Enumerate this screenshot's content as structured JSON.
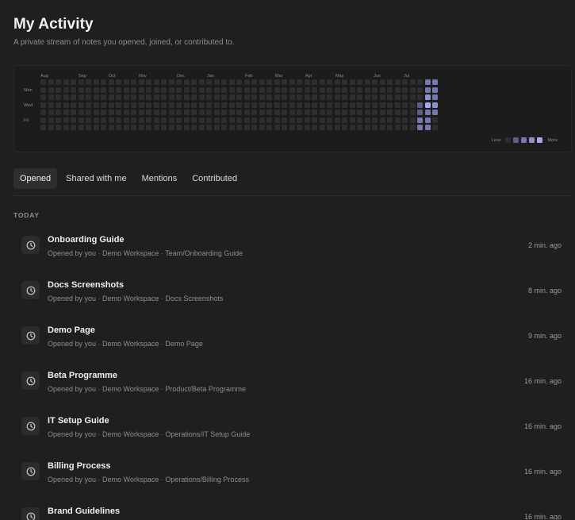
{
  "page": {
    "title": "My Activity",
    "subtitle": "A private stream of notes you opened, joined, or contributed to."
  },
  "heatmap": {
    "months": [
      "Aug",
      "Sep",
      "Oct",
      "Nov",
      "Dec",
      "Jan",
      "Feb",
      "Mar",
      "Apr",
      "May",
      "Jun",
      "Jul"
    ],
    "days": [
      "Mon",
      "Wed",
      "Fri"
    ],
    "legend_less": "Less",
    "legend_more": "More",
    "colors": {
      "empty": "#2e2e2e",
      "level1": "#5d5d85",
      "level2": "#7676b0",
      "level3": "#9090d0",
      "level4": "#a8a8e8"
    },
    "activity": [
      {
        "week": 50,
        "day": 0,
        "level": 0
      },
      {
        "week": 51,
        "day": 0,
        "level": 2
      },
      {
        "week": 52,
        "day": 0,
        "level": 2
      },
      {
        "week": 51,
        "day": 1,
        "level": 2
      },
      {
        "week": 52,
        "day": 1,
        "level": 2
      },
      {
        "week": 51,
        "day": 2,
        "level": 3
      },
      {
        "week": 52,
        "day": 2,
        "level": 2
      },
      {
        "week": 50,
        "day": 3,
        "level": 1
      },
      {
        "week": 51,
        "day": 3,
        "level": 4
      },
      {
        "week": 52,
        "day": 3,
        "level": 3
      },
      {
        "week": 50,
        "day": 4,
        "level": 1
      },
      {
        "week": 51,
        "day": 4,
        "level": 2
      },
      {
        "week": 52,
        "day": 4,
        "level": 2
      },
      {
        "week": 50,
        "day": 5,
        "level": 2
      },
      {
        "week": 51,
        "day": 5,
        "level": 2
      },
      {
        "week": 50,
        "day": 6,
        "level": 2
      },
      {
        "week": 51,
        "day": 6,
        "level": 2
      }
    ]
  },
  "tabs": [
    {
      "label": "Opened"
    },
    {
      "label": "Shared with me"
    },
    {
      "label": "Mentions"
    },
    {
      "label": "Contributed"
    }
  ],
  "section": {
    "label": "TODAY"
  },
  "items": [
    {
      "title": "Onboarding Guide",
      "meta": "Opened by you · Demo Workspace · Team/Onboarding Guide",
      "time": "2 min. ago",
      "icon": "clock-icon"
    },
    {
      "title": "Docs Screenshots",
      "meta": "Opened by you · Demo Workspace · Docs Screenshots",
      "time": "8 min. ago",
      "icon": "clock-icon"
    },
    {
      "title": "Demo Page",
      "meta": "Opened by you · Demo Workspace · Demo Page",
      "time": "9 min. ago",
      "icon": "clock-icon"
    },
    {
      "title": "Beta Programme",
      "meta": "Opened by you · Demo Workspace · Product/Beta Programme",
      "time": "16 min. ago",
      "icon": "clock-icon"
    },
    {
      "title": "IT Setup Guide",
      "meta": "Opened by you · Demo Workspace · Operations/IT Setup Guide",
      "time": "16 min. ago",
      "icon": "clock-icon"
    },
    {
      "title": "Billing Process",
      "meta": "Opened by you · Demo Workspace · Operations/Billing Process",
      "time": "16 min. ago",
      "icon": "clock-icon"
    },
    {
      "title": "Brand Guidelines",
      "meta": "",
      "time": "16 min. ago",
      "icon": "clock-icon"
    }
  ]
}
